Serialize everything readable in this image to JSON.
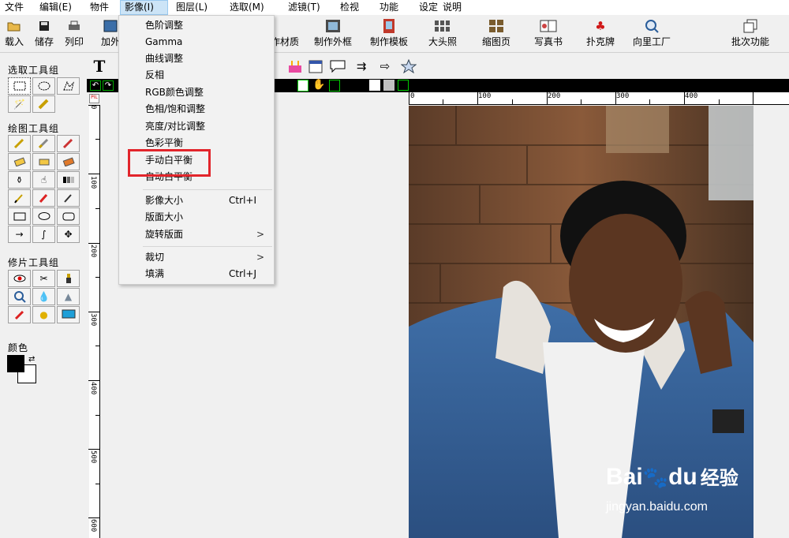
{
  "menubar": {
    "items": [
      "文件",
      "编辑(E)",
      "物件",
      "影像(I)",
      "图层(L)",
      "选取(M)",
      "滤镜(T)",
      "检视",
      "功能",
      "设定",
      "说明"
    ],
    "active_index": 3
  },
  "toolbar": {
    "buttons": [
      {
        "label": "载入",
        "icon": "folder-open-icon"
      },
      {
        "label": "储存",
        "icon": "floppy-disk-icon"
      },
      {
        "label": "列印",
        "icon": "printer-icon"
      },
      {
        "label": "加外",
        "icon": "frame-icon"
      },
      {
        "label": "作材质",
        "icon": "texture-icon"
      },
      {
        "label": "制作外框",
        "icon": "make-frame-icon"
      },
      {
        "label": "制作模板",
        "icon": "make-template-icon"
      },
      {
        "label": "大头照",
        "icon": "id-photo-icon"
      },
      {
        "label": "缩图页",
        "icon": "thumbnail-page-icon"
      },
      {
        "label": "写真书",
        "icon": "photo-book-icon"
      },
      {
        "label": "扑克牌",
        "icon": "playing-cards-icon"
      },
      {
        "label": "向里工厂",
        "icon": "factory-icon"
      },
      {
        "label": "批次功能",
        "icon": "batch-icon"
      }
    ]
  },
  "left_panel": {
    "select_group": "选取工具组",
    "draw_group": "绘图工具组",
    "retouch_group": "修片工具组",
    "color_label": "颜色"
  },
  "dropdown": {
    "items": [
      {
        "label": "色阶调整"
      },
      {
        "label": "Gamma"
      },
      {
        "label": "曲线调整"
      },
      {
        "label": "反相"
      },
      {
        "label": "RGB颜色调整"
      },
      {
        "label": "色相/饱和调整"
      },
      {
        "label": "亮度/对比调整"
      },
      {
        "label": "色彩平衡"
      },
      {
        "label": "手动白平衡"
      },
      {
        "label": "自动白平衡"
      },
      {
        "label": "影像大小",
        "shortcut": "Ctrl+I"
      },
      {
        "label": "版面大小"
      },
      {
        "label": "旋转版面",
        "submenu": ">"
      },
      {
        "label": "裁切",
        "submenu": ">"
      },
      {
        "label": "填满",
        "shortcut": "Ctrl+J"
      }
    ],
    "highlighted": "手动白平衡"
  },
  "ruler": {
    "h_labels": [
      "0",
      "100",
      "200",
      "300",
      "400"
    ],
    "v_labels": [
      "0",
      "100",
      "200",
      "300",
      "400",
      "500",
      "600"
    ]
  },
  "watermark": {
    "brand_left": "Bai",
    "brand_right": "du",
    "brand_cn": "经验",
    "url": "jingyan.baidu.com"
  },
  "colors": {
    "menu_active": "#cce4f7",
    "highlight_red": "#e2252b",
    "foreground_color": "#000000",
    "background_color": "#ffffff"
  }
}
